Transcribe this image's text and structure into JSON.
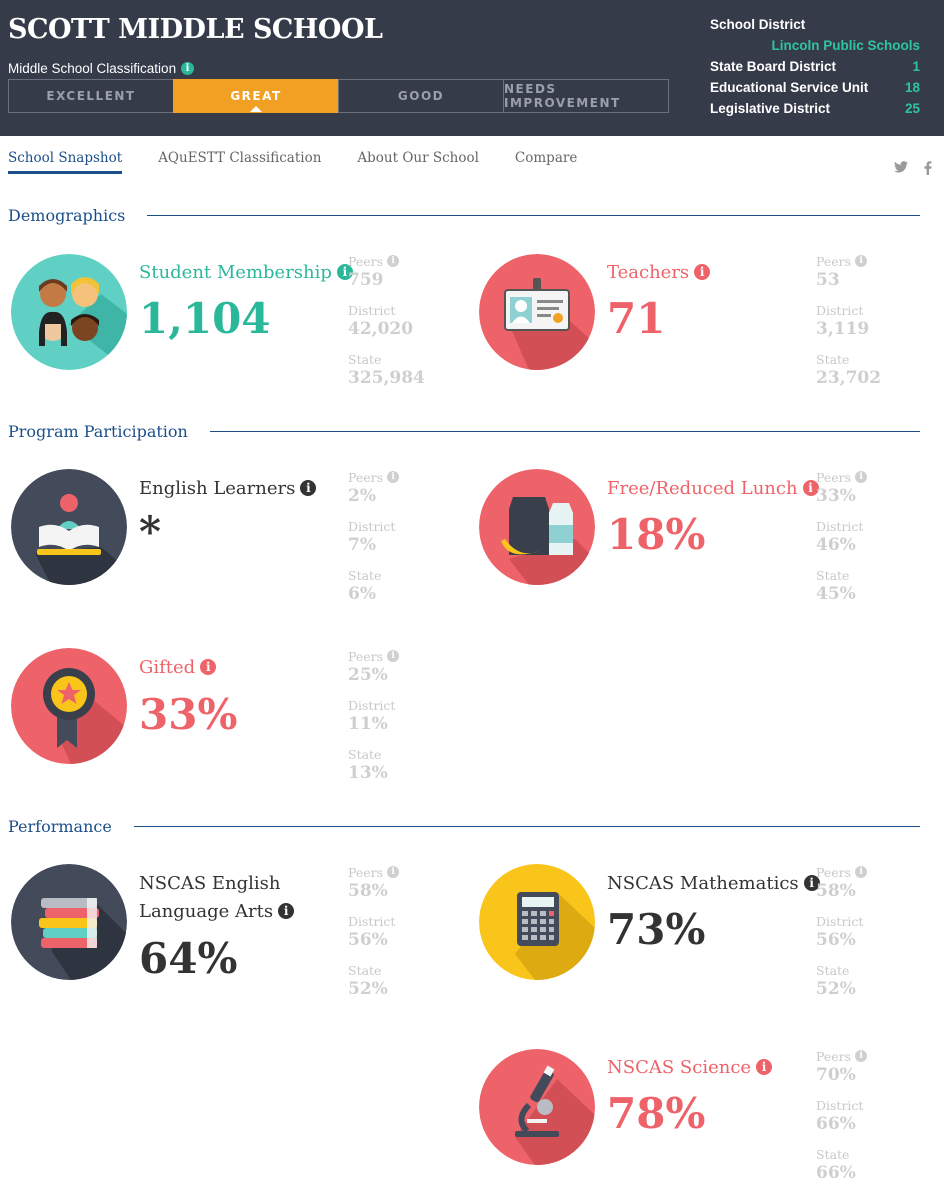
{
  "header": {
    "school_name": "SCOTT MIDDLE SCHOOL",
    "classification_label": "Middle School Classification",
    "classification_levels": [
      "EXCELLENT",
      "GREAT",
      "GOOD",
      "NEEDS IMPROVEMENT"
    ],
    "active_classification": "GREAT",
    "district_info": {
      "school_district_label": "School District",
      "school_district_value": "Lincoln Public Schools",
      "state_board_label": "State Board District",
      "state_board_value": "1",
      "esu_label": "Educational Service Unit",
      "esu_value": "18",
      "legislative_label": "Legislative District",
      "legislative_value": "25"
    }
  },
  "nav": {
    "tabs": [
      "School Snapshot",
      "AQuESTT Classification",
      "About Our School",
      "Compare"
    ],
    "active_tab": "School Snapshot",
    "social_icons": [
      "twitter-icon",
      "facebook-icon"
    ]
  },
  "info_glyph": "i",
  "comparison_labels": {
    "peers": "Peers",
    "district": "District",
    "state": "State"
  },
  "sections": {
    "demographics": "Demographics",
    "program_participation": "Program Participation",
    "performance": "Performance"
  },
  "colors": {
    "header_bg": "#363b4a",
    "accent_great": "#f2a024",
    "teal": "#2bb89a",
    "red": "#ee6369",
    "navy": "#1c4f8a",
    "yellow": "#f9c51b"
  },
  "stats": {
    "student_membership": {
      "label": "Student Membership",
      "value": "1,104",
      "peers": "759",
      "district": "42,020",
      "state": "325,984",
      "icon": "students-icon"
    },
    "teachers": {
      "label": "Teachers",
      "value": "71",
      "peers": "53",
      "district": "3,119",
      "state": "23,702",
      "icon": "id-badge-icon"
    },
    "english_learners": {
      "label": "English Learners",
      "value": "*",
      "peers": "2%",
      "district": "7%",
      "state": "6%",
      "icon": "reader-book-icon"
    },
    "free_reduced_lunch": {
      "label": "Free/Reduced Lunch",
      "value": "18%",
      "peers": "33%",
      "district": "46%",
      "state": "45%",
      "icon": "lunch-icon"
    },
    "gifted": {
      "label": "Gifted",
      "value": "33%",
      "peers": "25%",
      "district": "11%",
      "state": "13%",
      "icon": "ribbon-award-icon"
    },
    "nscas_ela": {
      "label_line1": "NSCAS English",
      "label_line2": "Language Arts",
      "value": "64%",
      "peers": "58%",
      "district": "56%",
      "state": "52%",
      "icon": "books-stack-icon"
    },
    "nscas_math": {
      "label": "NSCAS Mathematics",
      "value": "73%",
      "peers": "58%",
      "district": "56%",
      "state": "52%",
      "icon": "calculator-icon"
    },
    "nscas_science": {
      "label": "NSCAS Science",
      "value": "78%",
      "peers": "70%",
      "district": "66%",
      "state": "66%",
      "icon": "microscope-icon"
    }
  }
}
